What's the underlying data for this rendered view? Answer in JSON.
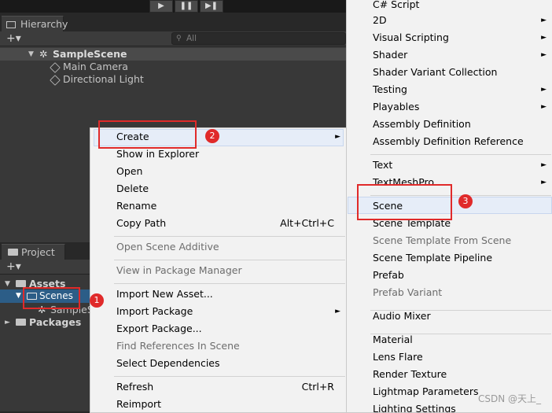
{
  "toolbar": {
    "play_icon": "play-icon",
    "pause_icon": "pause-icon",
    "step_icon": "step-icon"
  },
  "hierarchy": {
    "tab_label": "Hierarchy",
    "add_symbol": "+▾",
    "search_placeholder": "All",
    "scene": "SampleScene",
    "items": [
      "Main Camera",
      "Directional Light"
    ]
  },
  "project": {
    "tab_label": "Project",
    "add_symbol": "+▾",
    "tree": {
      "assets": "Assets",
      "scenes": "Scenes",
      "sample_scene": "SampleScene",
      "packages": "Packages"
    }
  },
  "context_menu": {
    "items": [
      {
        "label": "Create",
        "shortcut": "",
        "arrow": "►",
        "enabled": true
      },
      {
        "label": "Show in Explorer",
        "shortcut": "",
        "enabled": true
      },
      {
        "label": "Open",
        "shortcut": "",
        "enabled": true
      },
      {
        "label": "Delete",
        "shortcut": "",
        "enabled": true
      },
      {
        "label": "Rename",
        "shortcut": "",
        "enabled": true
      },
      {
        "label": "Copy Path",
        "shortcut": "Alt+Ctrl+C",
        "enabled": true
      },
      {
        "label": "Open Scene Additive",
        "shortcut": "",
        "enabled": false
      },
      {
        "label": "View in Package Manager",
        "shortcut": "",
        "enabled": false
      },
      {
        "label": "Import New Asset...",
        "shortcut": "",
        "enabled": true
      },
      {
        "label": "Import Package",
        "shortcut": "",
        "arrow": "►",
        "enabled": true
      },
      {
        "label": "Export Package...",
        "shortcut": "",
        "enabled": true
      },
      {
        "label": "Find References In Scene",
        "shortcut": "",
        "enabled": false
      },
      {
        "label": "Select Dependencies",
        "shortcut": "",
        "enabled": true
      },
      {
        "label": "Refresh",
        "shortcut": "Ctrl+R",
        "enabled": true
      },
      {
        "label": "Reimport",
        "shortcut": "",
        "enabled": true
      }
    ]
  },
  "create_submenu": {
    "items": [
      {
        "label": "C# Script",
        "enabled": true
      },
      {
        "label": "2D",
        "arrow": "►",
        "enabled": true
      },
      {
        "label": "Visual Scripting",
        "arrow": "►",
        "enabled": true
      },
      {
        "label": "Shader",
        "arrow": "►",
        "enabled": true
      },
      {
        "label": "Shader Variant Collection",
        "enabled": true
      },
      {
        "label": "Testing",
        "arrow": "►",
        "enabled": true
      },
      {
        "label": "Playables",
        "arrow": "►",
        "enabled": true
      },
      {
        "label": "Assembly Definition",
        "enabled": true
      },
      {
        "label": "Assembly Definition Reference",
        "enabled": true
      },
      {
        "label": "Text",
        "arrow": "►",
        "enabled": true
      },
      {
        "label": "TextMeshPro",
        "arrow": "►",
        "enabled": true
      },
      {
        "label": "Scene",
        "enabled": true
      },
      {
        "label": "Scene Template",
        "enabled": true
      },
      {
        "label": "Scene Template From Scene",
        "enabled": false
      },
      {
        "label": "Scene Template Pipeline",
        "enabled": true
      },
      {
        "label": "Prefab",
        "enabled": true
      },
      {
        "label": "Prefab Variant",
        "enabled": false
      },
      {
        "label": "Audio Mixer",
        "enabled": true
      },
      {
        "label": "Material",
        "enabled": true
      },
      {
        "label": "Lens Flare",
        "enabled": true
      },
      {
        "label": "Render Texture",
        "enabled": true
      },
      {
        "label": "Lightmap Parameters",
        "enabled": true
      },
      {
        "label": "Lighting Settings",
        "enabled": true
      }
    ]
  },
  "annotations": {
    "step1": "1",
    "step2": "2",
    "step3": "3",
    "color": "#e02a2a"
  },
  "watermark": "CSDN @天上_"
}
